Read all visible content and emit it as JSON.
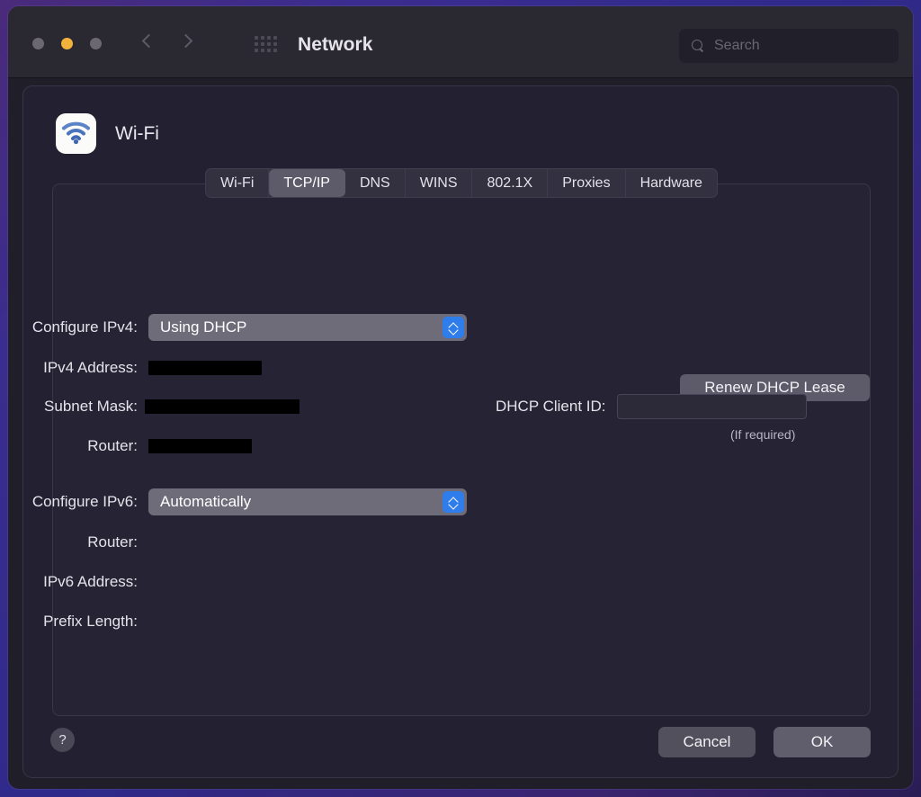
{
  "window": {
    "title": "Network",
    "traffic_lights": [
      {
        "name": "close",
        "color": "#6b6870"
      },
      {
        "name": "minimize",
        "color": "#f2b33c"
      },
      {
        "name": "zoom",
        "color": "#6b6870"
      }
    ],
    "back_icon": "chevron-left-icon",
    "forward_icon": "chevron-right-icon",
    "grid_icon": "show-all-grid-icon"
  },
  "search": {
    "placeholder": "Search",
    "value": "",
    "icon": "search-icon"
  },
  "sheet": {
    "title": "Wi-Fi",
    "icon": "wifi-icon"
  },
  "tabs": [
    {
      "label": "Wi-Fi",
      "selected": false
    },
    {
      "label": "TCP/IP",
      "selected": true
    },
    {
      "label": "DNS",
      "selected": false
    },
    {
      "label": "WINS",
      "selected": false
    },
    {
      "label": "802.1X",
      "selected": false
    },
    {
      "label": "Proxies",
      "selected": false
    },
    {
      "label": "Hardware",
      "selected": false
    }
  ],
  "ipv4": {
    "configure_label": "Configure IPv4:",
    "configure_value": "Using DHCP",
    "address_label": "IPv4 Address:",
    "address_value": "",
    "address_redacted": true,
    "subnet_label": "Subnet Mask:",
    "subnet_value": "",
    "subnet_redacted": true,
    "router_label": "Router:",
    "router_value": "",
    "router_redacted": true
  },
  "dhcp": {
    "renew_label": "Renew DHCP Lease",
    "client_id_label": "DHCP Client ID:",
    "client_id_value": "",
    "hint": "(If required)"
  },
  "ipv6": {
    "configure_label": "Configure IPv6:",
    "configure_value": "Automatically",
    "router_label": "Router:",
    "router_value": "",
    "address_label": "IPv6 Address:",
    "address_value": "",
    "prefix_label": "Prefix Length:",
    "prefix_value": ""
  },
  "footer": {
    "help_label": "?",
    "cancel_label": "Cancel",
    "ok_label": "OK"
  },
  "colors": {
    "accent_blue": "#2f7ceb",
    "window_bg": "#201e28",
    "sheet_bg": "#232131",
    "toolbar_bg": "#2a2830",
    "desktop_glow": "#3b2d8f",
    "redaction": "#000000"
  }
}
